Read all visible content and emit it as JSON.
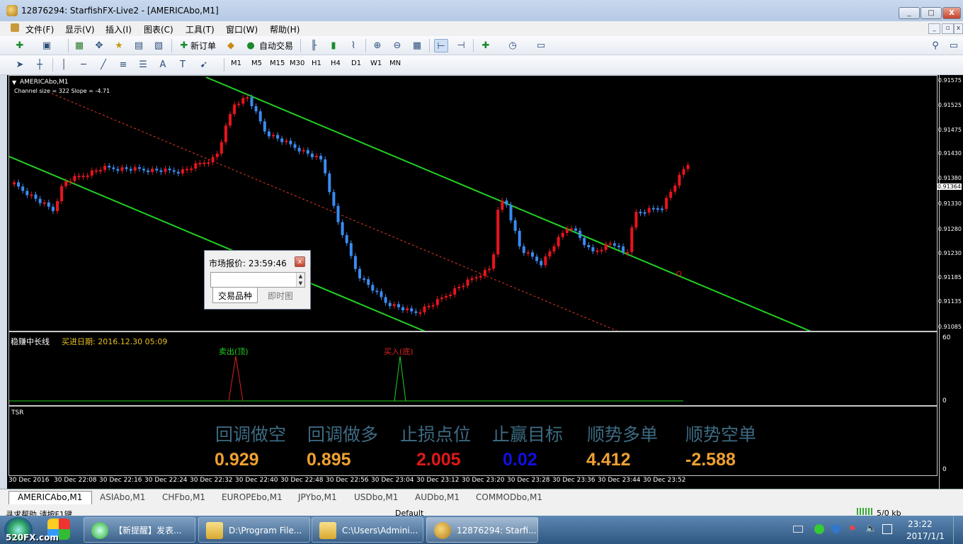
{
  "window": {
    "title": "12876294: StarfishFX-Live2 - [AMERICAbo,M1]",
    "min": "_",
    "max": "□",
    "close": "X"
  },
  "menu": [
    "文件(F)",
    "显示(V)",
    "插入(I)",
    "图表(C)",
    "工具(T)",
    "窗口(W)",
    "帮助(H)"
  ],
  "toolbar": {
    "new_order": "新订单",
    "auto_trade": "自动交易"
  },
  "timeframes": [
    "M1",
    "M5",
    "M15",
    "M30",
    "H1",
    "H4",
    "D1",
    "W1",
    "MN"
  ],
  "chart": {
    "symbol_label": "AMERICAbo,M1",
    "channel_info": "Channel size = 322  Slope = -4.71",
    "price_labels": [
      "0.91575",
      "0.91525",
      "0.91475",
      "0.91430",
      "0.91380",
      "0.91330",
      "0.91280",
      "0.91230",
      "0.91185",
      "0.91135",
      "0.91085"
    ],
    "current_price": "0.91364",
    "time_labels": [
      "30 Dec 2016",
      "30 Dec 22:08",
      "30 Dec 22:16",
      "30 Dec 22:24",
      "30 Dec 22:32",
      "30 Dec 22:40",
      "30 Dec 22:48",
      "30 Dec 22:56",
      "30 Dec 23:04",
      "30 Dec 23:12",
      "30 Dec 23:20",
      "30 Dec 23:28",
      "30 Dec 23:36",
      "30 Dec 23:44",
      "30 Dec 23:52"
    ],
    "colors": {
      "bull": "#e8141e",
      "bear": "#3a8bf0",
      "channel": "#22d022",
      "midline": "#e33a2a"
    }
  },
  "indicator1": {
    "name": "稳赚中长线",
    "buy_date": "买进日期: 2016.12.30 05:09",
    "sell_label": "卖出(顶)",
    "buy_label": "买入(底)",
    "scale_top": "60",
    "scale_bottom": "0"
  },
  "indicator2": {
    "name": "TSR",
    "scale_bottom": "0",
    "items": [
      {
        "label": "回调做空",
        "value": "0.929",
        "color": "#f0a030"
      },
      {
        "label": "回调做多",
        "value": "0.895",
        "color": "#f0a030"
      },
      {
        "label": "止损点位",
        "value": "2.005",
        "color": "#e01818"
      },
      {
        "label": "止赢目标",
        "value": "0.02",
        "color": "#1010e0"
      },
      {
        "label": "顺势多单",
        "value": "4.412",
        "color": "#f0a030"
      },
      {
        "label": "顺势空单",
        "value": "-2.588",
        "color": "#f0a030"
      }
    ]
  },
  "popup": {
    "title": "市场报价: 23:59:46",
    "tab1": "交易品种",
    "tab2": "即时图"
  },
  "tabs": [
    "AMERICAbo,M1",
    "ASIAbo,M1",
    "CHFbo,M1",
    "EUROPEbo,M1",
    "JPYbo,M1",
    "USDbo,M1",
    "AUDbo,M1",
    "COMMODbo,M1"
  ],
  "status": {
    "help": "寻求帮助,请按F1键",
    "profile": "Default",
    "traffic": "5/0 kb"
  },
  "taskbar": {
    "items": [
      "【新提醒】发表...",
      "D:\\Program File...",
      "C:\\Users\\Admini...",
      "12876294: Starfi..."
    ],
    "time": "23:22",
    "date": "2017/1/1",
    "watermark": "520FX.com"
  }
}
